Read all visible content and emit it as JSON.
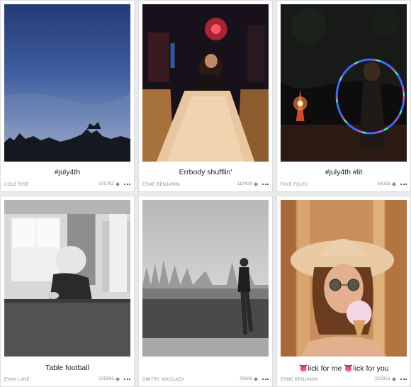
{
  "colors": {
    "page_bg": "#e9eaec",
    "card_bg": "#ffffff",
    "meta_text": "#8a8c90"
  },
  "cards": [
    {
      "title": "#july4th",
      "author": "COLE RISE",
      "count": "105792",
      "gem_icon": "diamond-icon",
      "more_icon": "more-horizontal-icon",
      "photo": "blue-twilight-sky-with-tree-silhouettes"
    },
    {
      "title": "Errbody shufflin'",
      "author": "ESME BENJAMIN",
      "count": "119429",
      "gem_icon": "diamond-icon",
      "more_icon": "more-horizontal-icon",
      "photo": "woman-at-shuffleboard-table-in-dark-bar"
    },
    {
      "title": "#july4th #lit",
      "author": "FAYE FOLEY",
      "count": "54383",
      "gem_icon": "diamond-icon",
      "more_icon": "more-horizontal-icon",
      "photo": "glowing-hula-hoop-and-sparkler-at-night"
    },
    {
      "title": "Table football",
      "author": "EVAN LANE",
      "count": "335895",
      "gem_icon": "diamond-icon",
      "more_icon": "more-horizontal-icon",
      "photo": "black-and-white-child-at-table"
    },
    {
      "title": "",
      "author": "DMITRY NIKOLAEV",
      "count": "78606",
      "gem_icon": "diamond-icon",
      "more_icon": "more-horizontal-icon",
      "photo": "black-and-white-boy-walking-in-field"
    },
    {
      "title": "👅lick for me 👅lick for you",
      "author": "ESME BENJAMIN",
      "count": "220931",
      "gem_icon": "diamond-icon",
      "more_icon": "more-horizontal-icon",
      "photo": "woman-in-straw-hat-with-ice-cream"
    }
  ]
}
